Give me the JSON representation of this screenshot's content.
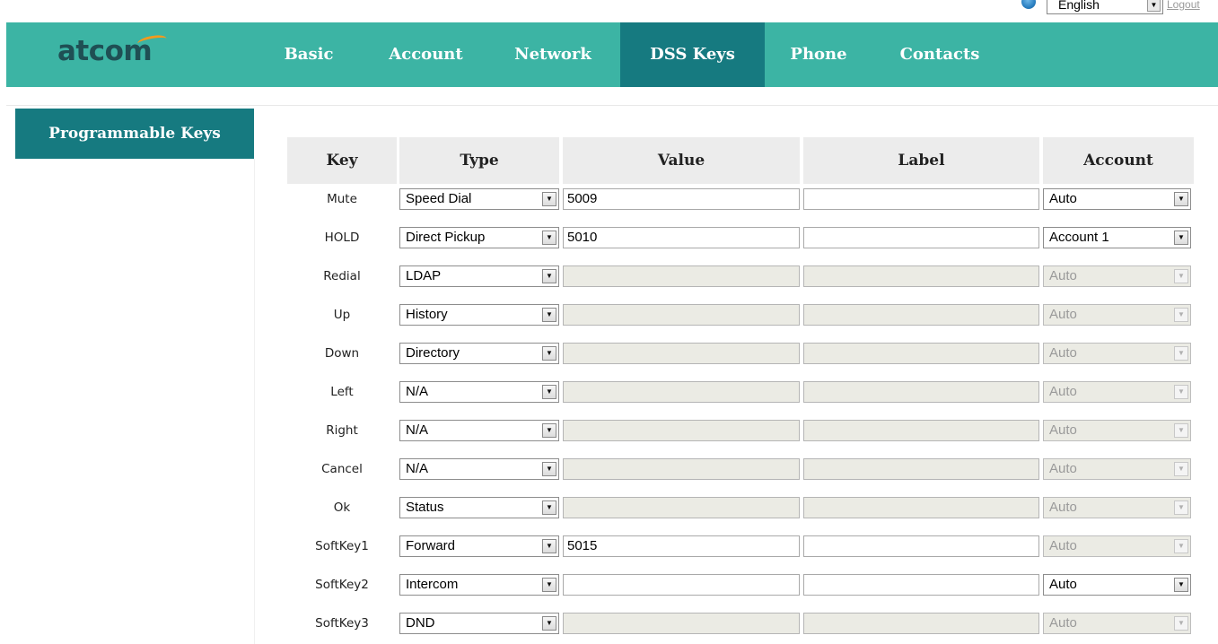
{
  "topbar": {
    "language": "English",
    "logout_label": "Logout"
  },
  "header": {
    "logo": "atcom",
    "tabs": [
      {
        "label": "Basic"
      },
      {
        "label": "Account"
      },
      {
        "label": "Network"
      },
      {
        "label": "DSS Keys",
        "active": true
      },
      {
        "label": "Phone"
      },
      {
        "label": "Contacts"
      }
    ]
  },
  "sidebar": {
    "items": [
      {
        "label": "Programmable Keys",
        "active": true
      }
    ]
  },
  "table": {
    "headers": {
      "key": "Key",
      "type": "Type",
      "value": "Value",
      "label": "Label",
      "account": "Account"
    },
    "rows": [
      {
        "key": "Mute",
        "type": "Speed Dial",
        "value": "5009",
        "label": "",
        "account": "Auto",
        "value_enabled": true,
        "account_enabled": true
      },
      {
        "key": "HOLD",
        "type": "Direct Pickup",
        "value": "5010",
        "label": "",
        "account": "Account 1",
        "value_enabled": true,
        "account_enabled": true
      },
      {
        "key": "Redial",
        "type": "LDAP",
        "value": "",
        "label": "",
        "account": "Auto",
        "value_enabled": false,
        "account_enabled": false
      },
      {
        "key": "Up",
        "type": "History",
        "value": "",
        "label": "",
        "account": "Auto",
        "value_enabled": false,
        "account_enabled": false
      },
      {
        "key": "Down",
        "type": "Directory",
        "value": "",
        "label": "",
        "account": "Auto",
        "value_enabled": false,
        "account_enabled": false
      },
      {
        "key": "Left",
        "type": "N/A",
        "value": "",
        "label": "",
        "account": "Auto",
        "value_enabled": false,
        "account_enabled": false
      },
      {
        "key": "Right",
        "type": "N/A",
        "value": "",
        "label": "",
        "account": "Auto",
        "value_enabled": false,
        "account_enabled": false
      },
      {
        "key": "Cancel",
        "type": "N/A",
        "value": "",
        "label": "",
        "account": "Auto",
        "value_enabled": false,
        "account_enabled": false
      },
      {
        "key": "Ok",
        "type": "Status",
        "value": "",
        "label": "",
        "account": "Auto",
        "value_enabled": false,
        "account_enabled": false
      },
      {
        "key": "SoftKey1",
        "type": "Forward",
        "value": "5015",
        "label": "",
        "account": "Auto",
        "value_enabled": true,
        "account_enabled": false
      },
      {
        "key": "SoftKey2",
        "type": "Intercom",
        "value": "",
        "label": "",
        "account": "Auto",
        "value_enabled": true,
        "account_enabled": true
      },
      {
        "key": "SoftKey3",
        "type": "DND",
        "value": "",
        "label": "",
        "account": "Auto",
        "value_enabled": false,
        "account_enabled": false
      }
    ]
  },
  "colors": {
    "header_bg": "#3cb4a4",
    "active_tab_bg": "#167a80",
    "logo_text": "#1f4f54",
    "logo_accent": "#f39a1d"
  }
}
